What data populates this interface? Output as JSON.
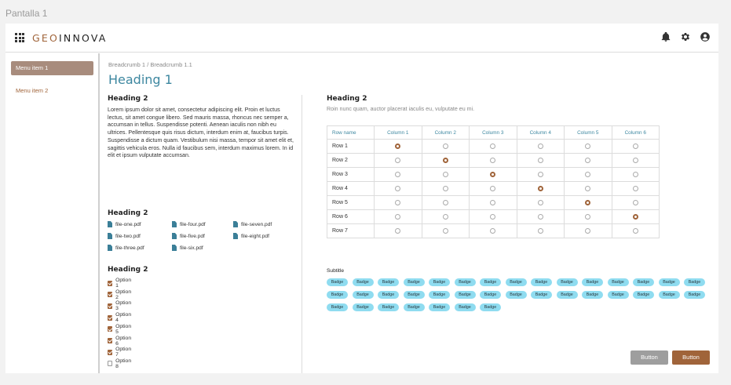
{
  "frame_label": "Pantalla 1",
  "brand": {
    "part1": "GEO",
    "part2": "INNOVA"
  },
  "header_icons": [
    "bell-icon",
    "gear-icon",
    "account-icon"
  ],
  "sidebar": {
    "items": [
      {
        "label": "Menu item 1",
        "active": true
      },
      {
        "label": "Menu item 2",
        "active": false
      }
    ]
  },
  "breadcrumb": {
    "item1": "Breadcrumb 1",
    "separator": "/",
    "item2": "Breadcrumb 1.1"
  },
  "page_title": "Heading 1",
  "left": {
    "text_heading": "Heading 2",
    "lorem": "Lorem ipsum dolor sit amet, consectetur adipiscing elit. Proin et luctus lectus, sit amet congue libero. Sed mauris massa, rhoncus nec semper a, accumsan in tellus. Suspendisse potenti. Aenean iaculis non nibh eu ultrices. Pellentesque quis risus dictum, interdum enim at, faucibus turpis. Suspendisse a dictum quam. Vestibulum nisi massa, tempor sit amet elit et, sagittis vehicula eros. Nulla id faucibus sem, interdum maximus lorem. In id elit et ipsum vulputate accumsan.",
    "files_heading": "Heading 2",
    "files": [
      "file-one.pdf",
      "file-two.pdf",
      "file-three.pdf",
      "file-four.pdf",
      "file-five.pdf",
      "file-six.pdf",
      "file-seven.pdf",
      "file-eight.pdf"
    ],
    "options_heading": "Heading 2",
    "options": [
      {
        "label": "Option 1",
        "checked": true
      },
      {
        "label": "Option 2",
        "checked": true
      },
      {
        "label": "Option 3",
        "checked": true
      },
      {
        "label": "Option 4",
        "checked": true
      },
      {
        "label": "Option 5",
        "checked": true
      },
      {
        "label": "Option 6",
        "checked": true
      },
      {
        "label": "Option 7",
        "checked": true
      },
      {
        "label": "Option 8",
        "checked": false
      }
    ]
  },
  "right": {
    "heading": "Heading 2",
    "subtitle": "Roin nunc quam, auctor placerat iaculis eu, vulputate eu mi.",
    "table": {
      "rowname_header": "Row name",
      "columns": [
        "Column 1",
        "Column 2",
        "Column 3",
        "Column 4",
        "Column 5",
        "Column 6"
      ],
      "rows": [
        {
          "label": "Row 1",
          "selected": 1
        },
        {
          "label": "Row 2",
          "selected": 2
        },
        {
          "label": "Row 3",
          "selected": 3
        },
        {
          "label": "Row 4",
          "selected": 4
        },
        {
          "label": "Row 5",
          "selected": 5
        },
        {
          "label": "Row 6",
          "selected": 6
        },
        {
          "label": "Row 7",
          "selected": 0
        }
      ]
    },
    "badges_title": "Subtitle",
    "badge_label": "Badge",
    "badge_count": 37
  },
  "buttons": {
    "secondary": "Button",
    "primary": "Button"
  },
  "colors": {
    "accent": "#a0643a",
    "heading": "#3d87a0",
    "badge": "#8fdcf0",
    "menu_active": "#a88c7d"
  }
}
